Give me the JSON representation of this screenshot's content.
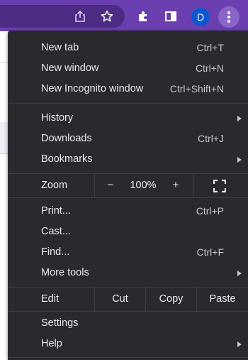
{
  "toolbar": {
    "avatar_initial": "D",
    "icons": [
      "share-icon",
      "star-icon",
      "extensions-icon",
      "side-panel-icon",
      "more-menu-icon"
    ]
  },
  "menu": {
    "new_tab": {
      "label": "New tab",
      "shortcut": "Ctrl+T"
    },
    "new_window": {
      "label": "New window",
      "shortcut": "Ctrl+N"
    },
    "new_incognito": {
      "label": "New Incognito window",
      "shortcut": "Ctrl+Shift+N"
    },
    "history": {
      "label": "History"
    },
    "downloads": {
      "label": "Downloads",
      "shortcut": "Ctrl+J"
    },
    "bookmarks": {
      "label": "Bookmarks"
    },
    "zoom": {
      "label": "Zoom",
      "minus": "−",
      "value": "100%",
      "plus": "+"
    },
    "print": {
      "label": "Print...",
      "shortcut": "Ctrl+P"
    },
    "cast": {
      "label": "Cast..."
    },
    "find": {
      "label": "Find...",
      "shortcut": "Ctrl+F"
    },
    "more_tools": {
      "label": "More tools"
    },
    "edit": {
      "label": "Edit",
      "cut": "Cut",
      "copy": "Copy",
      "paste": "Paste"
    },
    "settings": {
      "label": "Settings"
    },
    "help": {
      "label": "Help"
    }
  },
  "colors": {
    "toolbar": "#6b3fb0",
    "menu_bg": "#292a2d",
    "menu_text": "#e8eaed",
    "separator": "#3c4043",
    "avatar": "#0b57d0"
  }
}
